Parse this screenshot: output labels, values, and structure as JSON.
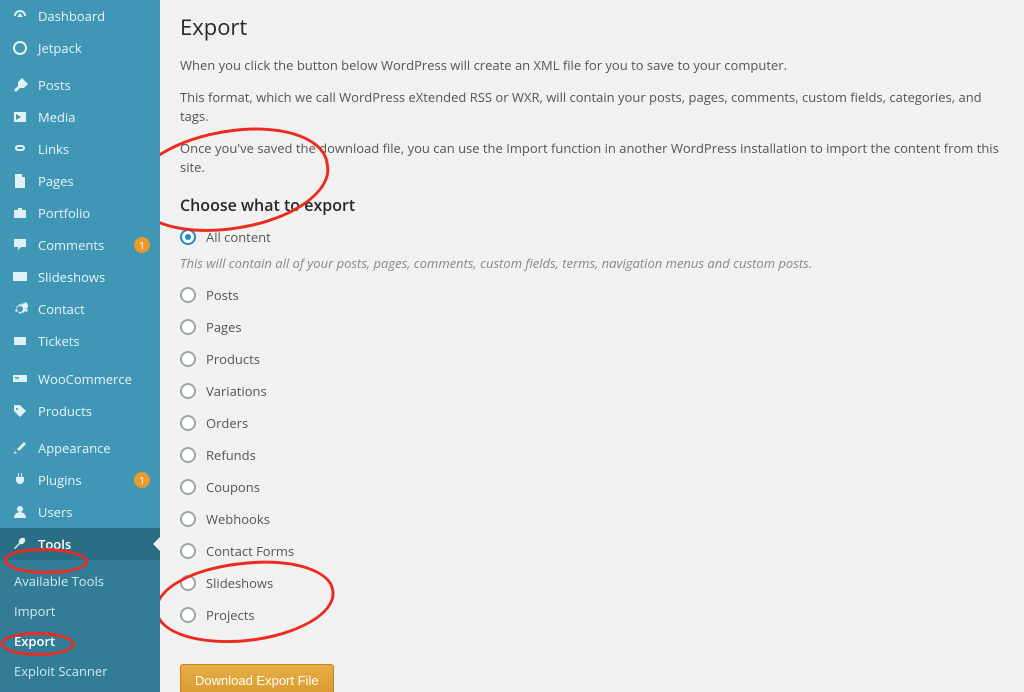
{
  "sidebar": {
    "items": [
      {
        "label": "Dashboard",
        "icon": "gauge"
      },
      {
        "label": "Jetpack",
        "icon": "circle"
      },
      {
        "label": "Posts",
        "icon": "pin",
        "sep_before": true
      },
      {
        "label": "Media",
        "icon": "media"
      },
      {
        "label": "Links",
        "icon": "link"
      },
      {
        "label": "Pages",
        "icon": "page"
      },
      {
        "label": "Portfolio",
        "icon": "briefcase"
      },
      {
        "label": "Comments",
        "icon": "comment",
        "badge": "1"
      },
      {
        "label": "Slideshows",
        "icon": "slides"
      },
      {
        "label": "Contact",
        "icon": "gear"
      },
      {
        "label": "Tickets",
        "icon": "ticket"
      },
      {
        "label": "WooCommerce",
        "icon": "woo",
        "sep_before": true
      },
      {
        "label": "Products",
        "icon": "tag"
      },
      {
        "label": "Appearance",
        "icon": "brush",
        "sep_before": true
      },
      {
        "label": "Plugins",
        "icon": "plug",
        "badge": "1"
      },
      {
        "label": "Users",
        "icon": "user"
      },
      {
        "label": "Tools",
        "icon": "wrench",
        "active": true
      }
    ],
    "submenu": [
      {
        "label": "Available Tools"
      },
      {
        "label": "Import"
      },
      {
        "label": "Export",
        "current": true
      },
      {
        "label": "Exploit Scanner"
      }
    ]
  },
  "page": {
    "title": "Export",
    "p1": "When you click the button below WordPress will create an XML file for you to save to your computer.",
    "p2": "This format, which we call WordPress eXtended RSS or WXR, will contain your posts, pages, comments, custom fields, categories, and tags.",
    "p3": "Once you've saved the download file, you can use the Import function in another WordPress installation to import the content from this site.",
    "section": "Choose what to export",
    "hint": "This will contain all of your posts, pages, comments, custom fields, terms, navigation menus and custom posts.",
    "download_label": "Download Export File",
    "options": [
      {
        "label": "All content",
        "checked": true
      },
      {
        "label": "Posts"
      },
      {
        "label": "Pages"
      },
      {
        "label": "Products"
      },
      {
        "label": "Variations"
      },
      {
        "label": "Orders"
      },
      {
        "label": "Refunds"
      },
      {
        "label": "Coupons"
      },
      {
        "label": "Webhooks"
      },
      {
        "label": "Contact Forms"
      },
      {
        "label": "Slideshows"
      },
      {
        "label": "Projects"
      }
    ]
  }
}
